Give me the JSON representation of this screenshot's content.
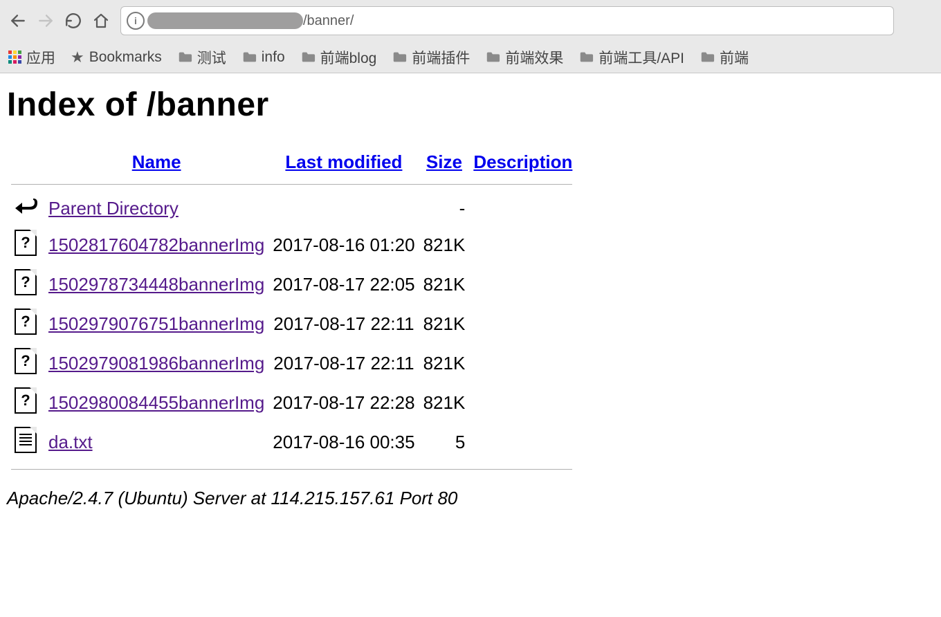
{
  "chrome": {
    "url_visible": "/banner/",
    "bookmarks": [
      {
        "label": "应用",
        "icon": "apps"
      },
      {
        "label": "Bookmarks",
        "icon": "star"
      },
      {
        "label": "测试",
        "icon": "folder"
      },
      {
        "label": "info",
        "icon": "folder"
      },
      {
        "label": "前端blog",
        "icon": "folder"
      },
      {
        "label": "前端插件",
        "icon": "folder"
      },
      {
        "label": "前端效果",
        "icon": "folder"
      },
      {
        "label": "前端工具/API",
        "icon": "folder"
      },
      {
        "label": "前端",
        "icon": "folder"
      }
    ]
  },
  "heading": "Index of /banner",
  "columns": {
    "name": "Name",
    "last_modified": "Last modified",
    "size": "Size",
    "description": "Description"
  },
  "rows": [
    {
      "icon": "back",
      "name": "Parent Directory",
      "last_modified": "",
      "size": "-",
      "description": ""
    },
    {
      "icon": "unknown",
      "name": "1502817604782bannerImg",
      "last_modified": "2017-08-16 01:20",
      "size": "821K",
      "description": ""
    },
    {
      "icon": "unknown",
      "name": "1502978734448bannerImg",
      "last_modified": "2017-08-17 22:05",
      "size": "821K",
      "description": ""
    },
    {
      "icon": "unknown",
      "name": "1502979076751bannerImg",
      "last_modified": "2017-08-17 22:11",
      "size": "821K",
      "description": ""
    },
    {
      "icon": "unknown",
      "name": "1502979081986bannerImg",
      "last_modified": "2017-08-17 22:11",
      "size": "821K",
      "description": ""
    },
    {
      "icon": "unknown",
      "name": "1502980084455bannerImg",
      "last_modified": "2017-08-17 22:28",
      "size": "821K",
      "description": ""
    },
    {
      "icon": "text",
      "name": "da.txt",
      "last_modified": "2017-08-16 00:35",
      "size": "5",
      "description": ""
    }
  ],
  "footer": "Apache/2.4.7 (Ubuntu) Server at 114.215.157.61 Port 80"
}
